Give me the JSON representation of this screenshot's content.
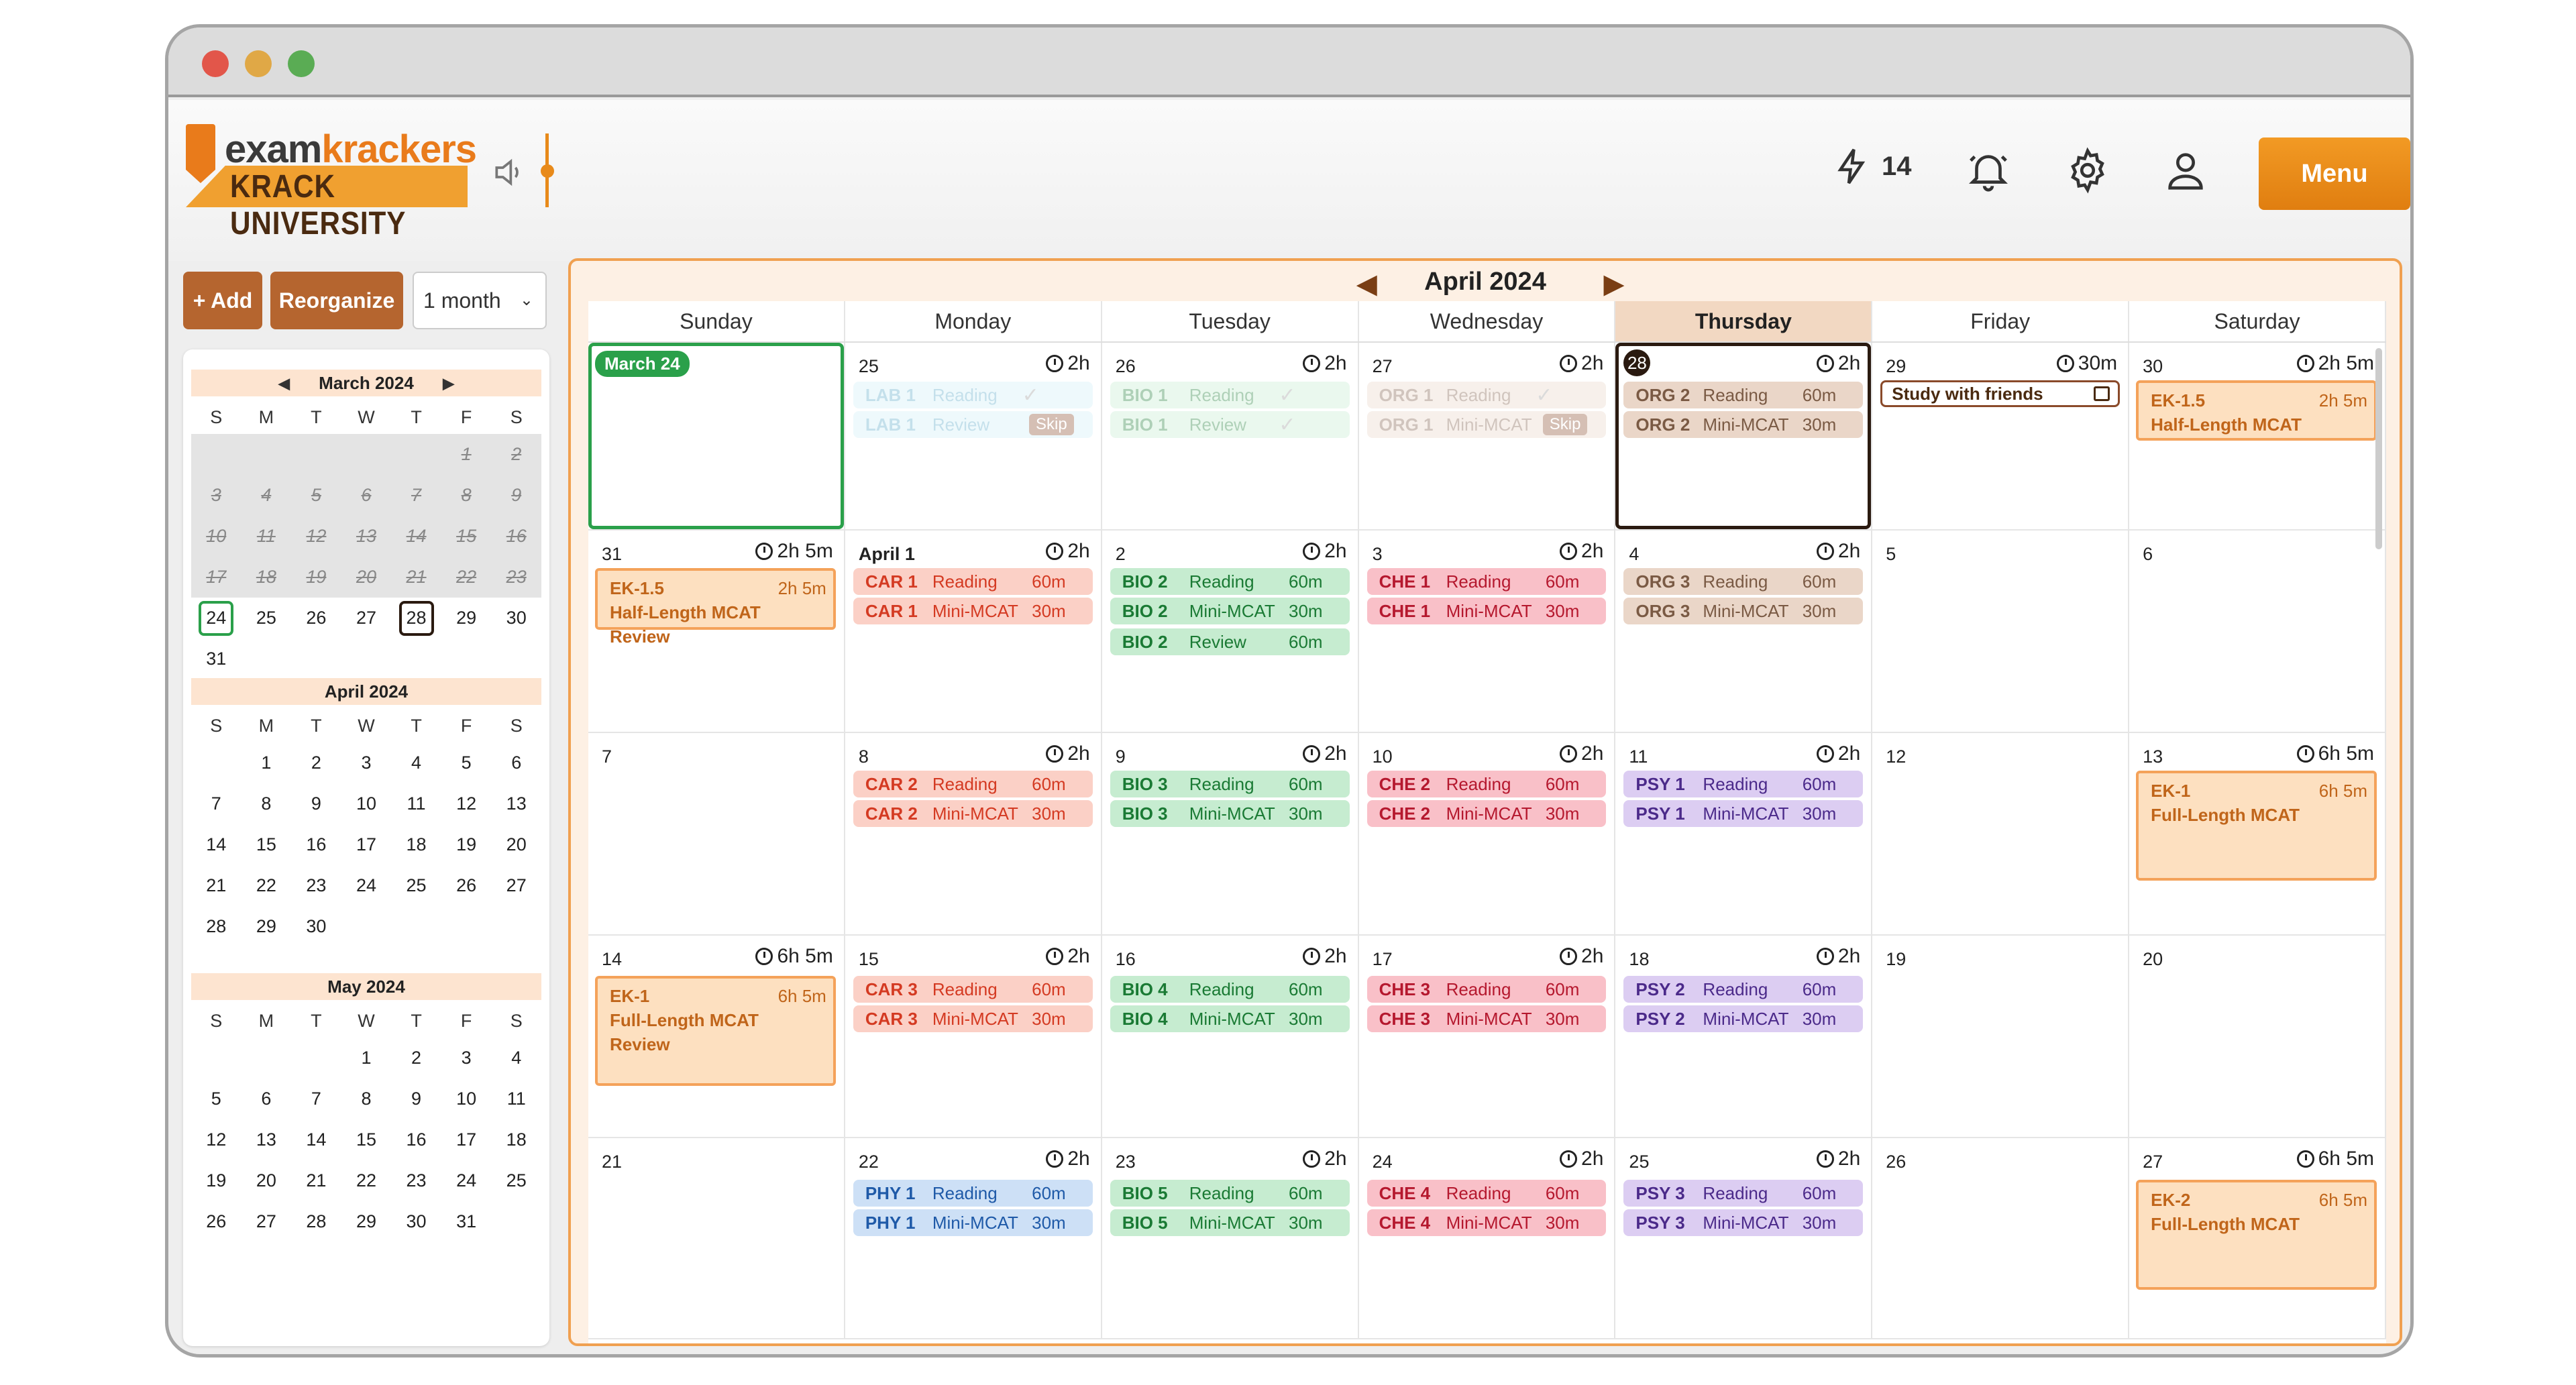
{
  "logo": {
    "top_a": "exam",
    "top_b": "krackers",
    "bottom": "KRACK UNIVERSITY"
  },
  "header": {
    "streak_count": "14",
    "menu_label": "Menu"
  },
  "toolbar": {
    "add": "+ Add",
    "reorganize": "Reorganize",
    "range": "1 month"
  },
  "calendar": {
    "title": "April 2024",
    "dow": [
      "Sunday",
      "Monday",
      "Tuesday",
      "Wednesday",
      "Thursday",
      "Friday",
      "Saturday"
    ],
    "today_chip": "March 24",
    "cells": {
      "c25": {
        "num": "25",
        "time": "2h"
      },
      "c26": {
        "num": "26",
        "time": "2h"
      },
      "c27": {
        "num": "27",
        "time": "2h"
      },
      "c28": {
        "num": "28",
        "time": "2h"
      },
      "c29": {
        "num": "29",
        "time": "30m"
      },
      "c30": {
        "num": "30",
        "time": "2h 5m"
      },
      "c31": {
        "num": "31",
        "time": "2h 5m"
      },
      "a1": {
        "num": "April 1",
        "time": "2h"
      },
      "a2": {
        "num": "2",
        "time": "2h"
      },
      "a3": {
        "num": "3",
        "time": "2h"
      },
      "a4": {
        "num": "4",
        "time": "2h"
      },
      "a5": {
        "num": "5"
      },
      "a6": {
        "num": "6"
      },
      "a7": {
        "num": "7"
      },
      "a8": {
        "num": "8",
        "time": "2h"
      },
      "a9": {
        "num": "9",
        "time": "2h"
      },
      "a10": {
        "num": "10",
        "time": "2h"
      },
      "a11": {
        "num": "11",
        "time": "2h"
      },
      "a12": {
        "num": "12"
      },
      "a13": {
        "num": "13",
        "time": "6h 5m"
      },
      "a14": {
        "num": "14",
        "time": "6h 5m"
      },
      "a15": {
        "num": "15",
        "time": "2h"
      },
      "a16": {
        "num": "16",
        "time": "2h"
      },
      "a17": {
        "num": "17",
        "time": "2h"
      },
      "a18": {
        "num": "18",
        "time": "2h"
      },
      "a19": {
        "num": "19"
      },
      "a20": {
        "num": "20"
      },
      "a21": {
        "num": "21"
      },
      "a22": {
        "num": "22",
        "time": "2h"
      },
      "a23": {
        "num": "23",
        "time": "2h"
      },
      "a24": {
        "num": "24",
        "time": "2h"
      },
      "a25": {
        "num": "25",
        "time": "2h"
      },
      "a26": {
        "num": "26"
      },
      "a27": {
        "num": "27",
        "time": "6h 5m"
      }
    },
    "events": {
      "lab1r": {
        "c": "LAB 1",
        "k": "Reading"
      },
      "lab1v": {
        "c": "LAB 1",
        "k": "Review",
        "skip": "Skip"
      },
      "bio1r": {
        "c": "BIO 1",
        "k": "Reading"
      },
      "bio1v": {
        "c": "BIO 1",
        "k": "Review"
      },
      "org1r": {
        "c": "ORG 1",
        "k": "Reading"
      },
      "org1m": {
        "c": "ORG 1",
        "k": "Mini-MCAT",
        "skip": "Skip"
      },
      "org2r": {
        "c": "ORG 2",
        "k": "Reading",
        "d": "60m"
      },
      "org2m": {
        "c": "ORG 2",
        "k": "Mini-MCAT",
        "d": "30m"
      },
      "note29": "Study with friends",
      "ek15a": {
        "t": "EK-1.5",
        "d": "2h 5m",
        "s": "Half-Length MCAT"
      },
      "ek15b": {
        "t": "EK-1.5",
        "d": "2h 5m",
        "s": "Half-Length MCAT Review"
      },
      "car1r": {
        "c": "CAR 1",
        "k": "Reading",
        "d": "60m"
      },
      "car1m": {
        "c": "CAR 1",
        "k": "Mini-MCAT",
        "d": "30m"
      },
      "bio2r": {
        "c": "BIO 2",
        "k": "Reading",
        "d": "60m"
      },
      "bio2m": {
        "c": "BIO 2",
        "k": "Mini-MCAT",
        "d": "30m"
      },
      "bio2v": {
        "c": "BIO 2",
        "k": "Review",
        "d": "60m"
      },
      "che1r": {
        "c": "CHE 1",
        "k": "Reading",
        "d": "60m"
      },
      "che1m": {
        "c": "CHE 1",
        "k": "Mini-MCAT",
        "d": "30m"
      },
      "org3r": {
        "c": "ORG 3",
        "k": "Reading",
        "d": "60m"
      },
      "org3m": {
        "c": "ORG 3",
        "k": "Mini-MCAT",
        "d": "30m"
      },
      "car2r": {
        "c": "CAR 2",
        "k": "Reading",
        "d": "60m"
      },
      "car2m": {
        "c": "CAR 2",
        "k": "Mini-MCAT",
        "d": "30m"
      },
      "bio3r": {
        "c": "BIO 3",
        "k": "Reading",
        "d": "60m"
      },
      "bio3m": {
        "c": "BIO 3",
        "k": "Mini-MCAT",
        "d": "30m"
      },
      "che2r": {
        "c": "CHE 2",
        "k": "Reading",
        "d": "60m"
      },
      "che2m": {
        "c": "CHE 2",
        "k": "Mini-MCAT",
        "d": "30m"
      },
      "psy1r": {
        "c": "PSY 1",
        "k": "Reading",
        "d": "60m"
      },
      "psy1m": {
        "c": "PSY 1",
        "k": "Mini-MCAT",
        "d": "30m"
      },
      "ek1a": {
        "t": "EK-1",
        "d": "6h 5m",
        "s": "Full-Length MCAT"
      },
      "ek1b": {
        "t": "EK-1",
        "d": "6h 5m",
        "s": "Full-Length MCAT",
        "s2": "Review"
      },
      "car3r": {
        "c": "CAR 3",
        "k": "Reading",
        "d": "60m"
      },
      "car3m": {
        "c": "CAR 3",
        "k": "Mini-MCAT",
        "d": "30m"
      },
      "bio4r": {
        "c": "BIO 4",
        "k": "Reading",
        "d": "60m"
      },
      "bio4m": {
        "c": "BIO 4",
        "k": "Mini-MCAT",
        "d": "30m"
      },
      "che3r": {
        "c": "CHE 3",
        "k": "Reading",
        "d": "60m"
      },
      "che3m": {
        "c": "CHE 3",
        "k": "Mini-MCAT",
        "d": "30m"
      },
      "psy2r": {
        "c": "PSY 2",
        "k": "Reading",
        "d": "60m"
      },
      "psy2m": {
        "c": "PSY 2",
        "k": "Mini-MCAT",
        "d": "30m"
      },
      "phy1r": {
        "c": "PHY 1",
        "k": "Reading",
        "d": "60m"
      },
      "phy1m": {
        "c": "PHY 1",
        "k": "Mini-MCAT",
        "d": "30m"
      },
      "bio5r": {
        "c": "BIO 5",
        "k": "Reading",
        "d": "60m"
      },
      "bio5m": {
        "c": "BIO 5",
        "k": "Mini-MCAT",
        "d": "30m"
      },
      "che4r": {
        "c": "CHE 4",
        "k": "Reading",
        "d": "60m"
      },
      "che4m": {
        "c": "CHE 4",
        "k": "Mini-MCAT",
        "d": "30m"
      },
      "psy3r": {
        "c": "PSY 3",
        "k": "Reading",
        "d": "60m"
      },
      "psy3m": {
        "c": "PSY 3",
        "k": "Mini-MCAT",
        "d": "30m"
      },
      "ek2": {
        "t": "EK-2",
        "d": "6h 5m",
        "s": "Full-Length MCAT"
      }
    }
  },
  "mini": {
    "dow": [
      "S",
      "M",
      "T",
      "W",
      "T",
      "F",
      "S"
    ],
    "months": [
      {
        "title": "March 2024",
        "start": 5,
        "days": 31,
        "past_to": 23,
        "today": 24,
        "selected": 28,
        "lead": []
      },
      {
        "title": "April 2024",
        "start": 1,
        "days": 30
      },
      {
        "title": "May 2024",
        "start": 3,
        "days": 31
      }
    ]
  }
}
